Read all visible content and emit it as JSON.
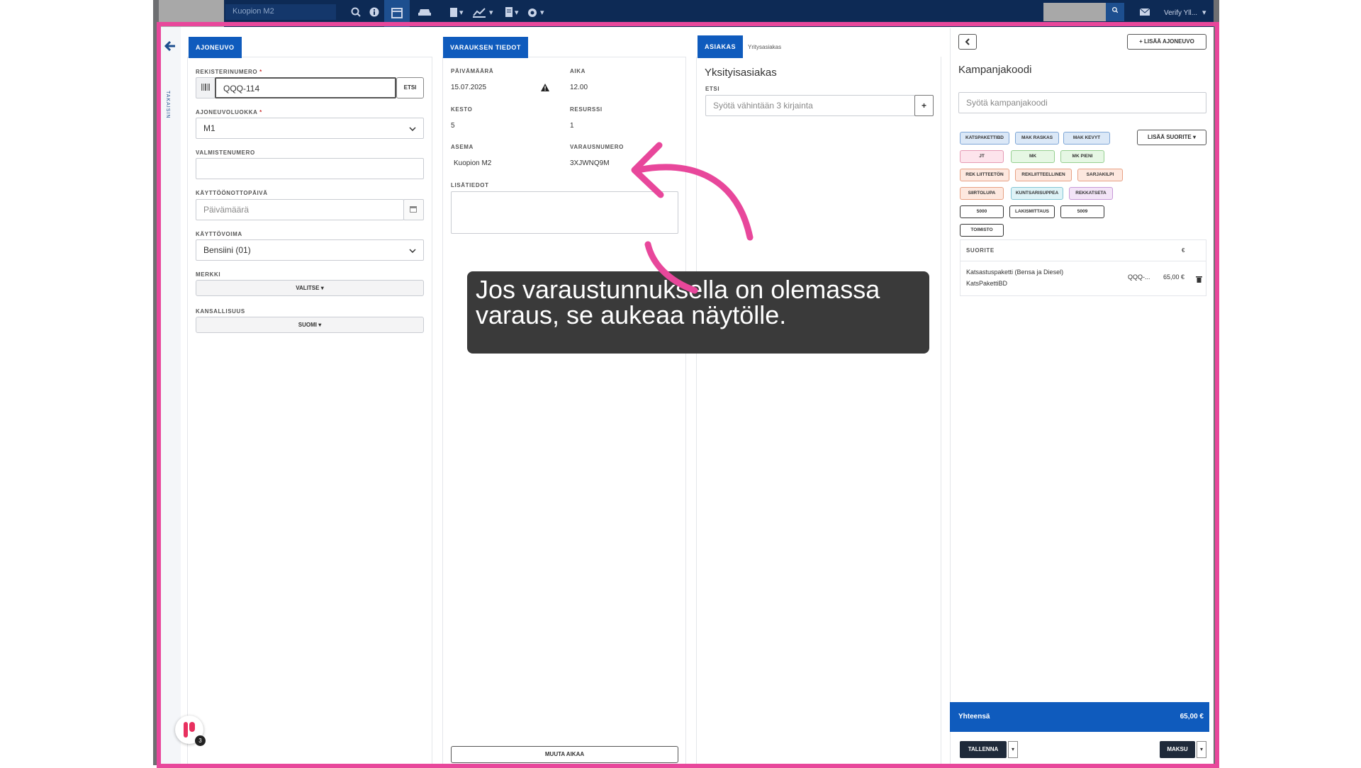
{
  "topbar": {
    "location": "Kuopion M2",
    "user": "Verify Yll...",
    "caret": "▾",
    "icons": [
      "search-icon",
      "info-icon",
      "calendar-icon",
      "car-icon",
      "clipboard-icon",
      "chart-icon",
      "document-icon",
      "gear-icon",
      "mail-icon"
    ]
  },
  "sidebar": {
    "vertical_label": "TAKAISIN"
  },
  "vehicle": {
    "tab": "AJONEUVO",
    "reg_label": "REKISTERINUMERO",
    "reg_value": "QQQ-114",
    "search_btn": "ETSI",
    "class_label": "AJONEUVOLUOKKA",
    "class_value": "M1",
    "vin_label": "VALMISTENUMERO",
    "vin_value": "",
    "intro_label": "KÄYTTÖÖNOTTOPÄIVÄ",
    "intro_placeholder": "Päivämäärä",
    "fuel_label": "KÄYTTÖVOIMA",
    "fuel_value": "Bensiini (01)",
    "make_label": "MERKKI",
    "make_btn": "VALITSE",
    "nationality_label": "KANSALLISUUS",
    "nationality_btn": "SUOMI",
    "required": "*"
  },
  "booking": {
    "tab": "VARAUKSEN TIEDOT",
    "date_label": "PÄIVÄMÄÄRÄ",
    "date_value": "15.07.2025",
    "time_label": "AIKA",
    "time_value": "12.00",
    "duration_label": "KESTO",
    "duration_value": "5",
    "resource_label": "RESURSSI",
    "resource_value": "1",
    "station_label": "ASEMA",
    "station_value": "Kuopion M2",
    "booking_no_label": "VARAUSNUMERO",
    "booking_no_value": "3XJWNQ9M",
    "notes_label": "LISÄTIEDOT",
    "change_time_btn": "MUUTA AIKAA"
  },
  "customer": {
    "tab_active": "ASIAKAS",
    "tab_other": "Yritysasiakas",
    "heading": "Yksityisasiakas",
    "search_label": "ETSI",
    "search_placeholder": "Syötä vähintään 3 kirjainta",
    "add_symbol": "+"
  },
  "campaign": {
    "add_vehicle_btn": "LISÄÄ AJONEUVO",
    "heading": "Kampanjakoodi",
    "code_placeholder": "Syötä kampanjakoodi",
    "add_service_btn": "LISÄÄ SUORITE",
    "chips": [
      {
        "label": "KATSPAKETTIBD",
        "color": "#dbe8f7"
      },
      {
        "label": "MAK RASKAS",
        "color": "#dbe8f7"
      },
      {
        "label": "MAK KEVYT",
        "color": "#dbe8f7"
      },
      {
        "label": "JT",
        "color": "#fde4ec"
      },
      {
        "label": "MK",
        "color": "#e6f7e4"
      },
      {
        "label": "MK PIENI",
        "color": "#e6f7e4"
      },
      {
        "label": "REK LIITTEETÖN",
        "color": "#fde8df"
      },
      {
        "label": "REKLIITTEELLINEN",
        "color": "#fde8df"
      },
      {
        "label": "SARJAKILPI",
        "color": "#fde8df"
      },
      {
        "label": "SIIRTOLUPA",
        "color": "#fde8df"
      },
      {
        "label": "KUNTSARISUPPEA",
        "color": "#def3f7"
      },
      {
        "label": "REKKATSETA",
        "color": "#f3e4f7"
      },
      {
        "label": "5000",
        "color": "#ffffff"
      },
      {
        "label": "LAKISMITTAUS",
        "color": "#ffffff"
      },
      {
        "label": "5009",
        "color": "#ffffff"
      },
      {
        "label": "TOIMISTO",
        "color": "#ffffff"
      }
    ],
    "table_header": "SUORITE",
    "table_currency": "€",
    "item_name": "Katsastuspaketti (Bensa ja Diesel)",
    "item_code": "KatsPakettiBD",
    "item_vehicle": "QQQ-...",
    "item_price": "65,00 €",
    "total_label": "Yhteensä",
    "total_value": "65,00 €",
    "save_btn": "TALLENNA",
    "pay_btn": "MAKSU"
  },
  "annotation": {
    "text": "Jos varaustunnuksella on olemassa varaus, se aukeaa näytölle.",
    "badge_count": "3",
    "accent": "#e8479b"
  }
}
